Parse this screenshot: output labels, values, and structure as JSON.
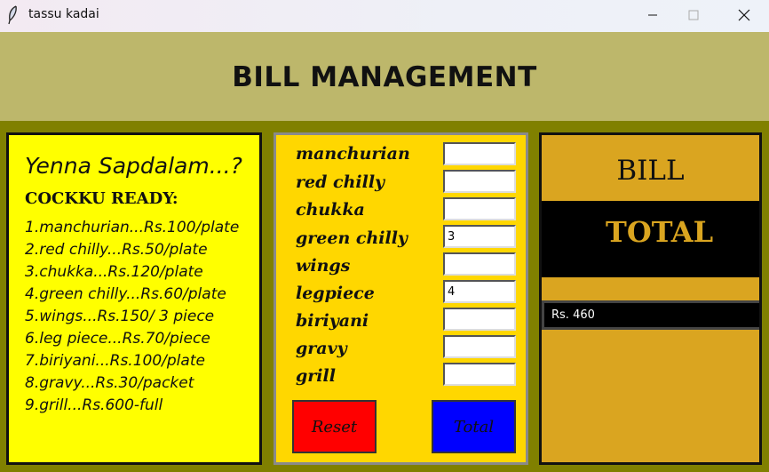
{
  "window": {
    "title": "tassu kadai",
    "icon": "feather-icon"
  },
  "header": {
    "title": "BILL MANAGEMENT"
  },
  "menu": {
    "heading": "Yenna Sapdalam...?",
    "subheading": "COCKKU READY:",
    "items": [
      "1.manchurian...Rs.100/plate",
      "2.red chilly...Rs.50/plate",
      "3.chukka...Rs.120/plate",
      "4.green chilly...Rs.60/plate",
      "5.wings...Rs.150/ 3 piece",
      "6.leg piece...Rs.70/piece",
      "7.biriyani...Rs.100/plate",
      "8.gravy...Rs.30/packet",
      "9.grill...Rs.600-full"
    ]
  },
  "order": {
    "items": [
      {
        "label": "manchurian",
        "value": ""
      },
      {
        "label": "red chilly",
        "value": ""
      },
      {
        "label": "chukka",
        "value": ""
      },
      {
        "label": "green chilly",
        "value": "3"
      },
      {
        "label": "wings",
        "value": ""
      },
      {
        "label": "legpiece",
        "value": "4"
      },
      {
        "label": "biriyani",
        "value": ""
      },
      {
        "label": "gravy",
        "value": ""
      },
      {
        "label": "grill",
        "value": ""
      }
    ],
    "reset_label": "Reset",
    "total_label": "Total"
  },
  "bill": {
    "title": "BILL",
    "total_heading": "TOTAL",
    "total_value": "Rs. 460"
  },
  "colors": {
    "background": "#808000",
    "header": "#bdb76b",
    "menu_panel": "#ffff00",
    "order_panel": "#ffd700",
    "bill_panel": "#daa520",
    "reset_button": "#ff0000",
    "total_button": "#0000ff"
  }
}
